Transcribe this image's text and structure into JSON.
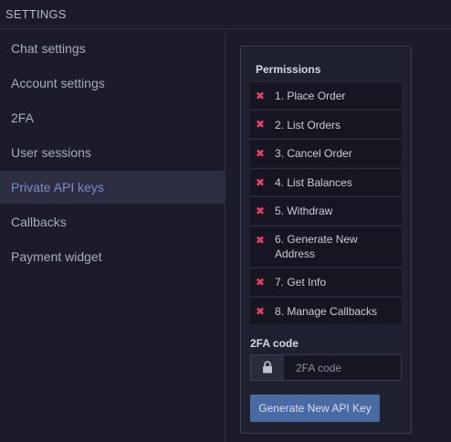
{
  "header": {
    "title": "SETTINGS"
  },
  "sidebar": {
    "items": [
      {
        "label": "Chat settings"
      },
      {
        "label": "Account settings"
      },
      {
        "label": "2FA"
      },
      {
        "label": "User sessions"
      },
      {
        "label": "Private API keys",
        "active": true
      },
      {
        "label": "Callbacks"
      },
      {
        "label": "Payment widget"
      }
    ]
  },
  "permissions": {
    "heading": "Permissions",
    "items": [
      {
        "label": "1. Place Order",
        "granted": false,
        "icon": "cross-icon"
      },
      {
        "label": "2. List Orders",
        "granted": false,
        "icon": "cross-icon"
      },
      {
        "label": "3. Cancel Order",
        "granted": false,
        "icon": "cross-icon"
      },
      {
        "label": "4. List Balances",
        "granted": false,
        "icon": "cross-icon"
      },
      {
        "label": "5. Withdraw",
        "granted": false,
        "icon": "cross-icon"
      },
      {
        "label": "6. Generate New Address",
        "granted": false,
        "icon": "cross-icon"
      },
      {
        "label": "7. Get Info",
        "granted": false,
        "icon": "cross-icon"
      },
      {
        "label": "8. Manage Callbacks",
        "granted": false,
        "icon": "cross-icon"
      }
    ],
    "cross_symbol": "✖"
  },
  "twofa": {
    "label": "2FA code",
    "value": "",
    "placeholder": "2FA code",
    "icon": "lock-icon"
  },
  "actions": {
    "generate_label": "Generate New API Key"
  },
  "colors": {
    "accent": "#4a6aa3",
    "active_nav_text": "#7a8cc8",
    "denied": "#e8406a"
  }
}
